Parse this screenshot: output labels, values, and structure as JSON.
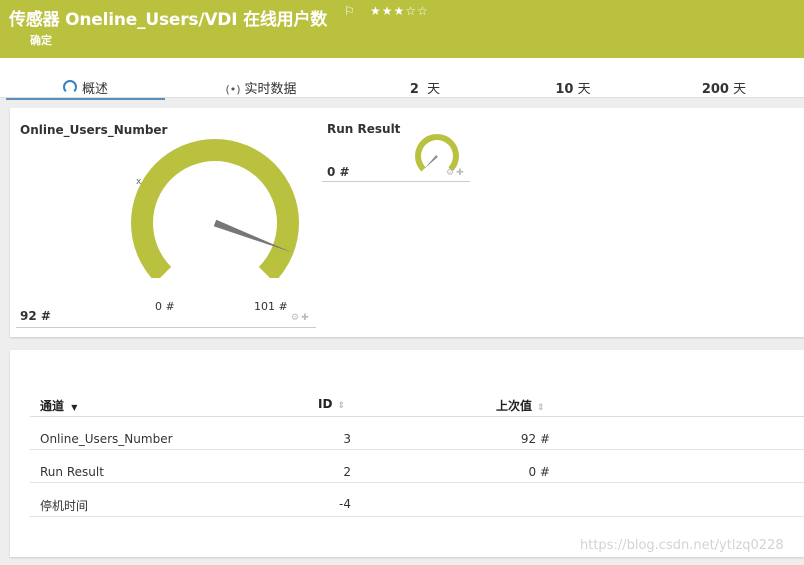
{
  "header": {
    "title": "传感器 Oneline_Users/VDI 在线用户数",
    "flag": "⚐",
    "stars": "★★★☆☆",
    "subtitle": "确定"
  },
  "tabs": [
    {
      "label": "概述",
      "icon": "gauge-icon",
      "active": true
    },
    {
      "label": "实时数据",
      "icon": "live-signal-icon"
    },
    {
      "num": "2",
      "unit": "天"
    },
    {
      "num": "10",
      "unit": "天"
    },
    {
      "num": "200",
      "unit": "天"
    }
  ],
  "gauges": {
    "main": {
      "name": "Online_Users_Number",
      "value": "92 #",
      "min_label": "0 #",
      "max_label": "101 #",
      "value_num": 92,
      "min": 0,
      "max": 101,
      "marker": "x",
      "color": "#b9c13f"
    },
    "small": {
      "name": "Run Result",
      "value": "0 #",
      "value_num": 0,
      "color": "#b9c13f"
    }
  },
  "table": {
    "headers": {
      "channel": "通道",
      "id": "ID",
      "last_value": "上次值"
    },
    "rows": [
      {
        "channel": "Online_Users_Number",
        "id": "3",
        "last_value": "92 #"
      },
      {
        "channel": "Run Result",
        "id": "2",
        "last_value": "0 #"
      },
      {
        "channel": "停机时间",
        "id": "-4",
        "last_value": ""
      }
    ]
  },
  "watermark": "https://blog.csdn.net/ytlzq0228"
}
